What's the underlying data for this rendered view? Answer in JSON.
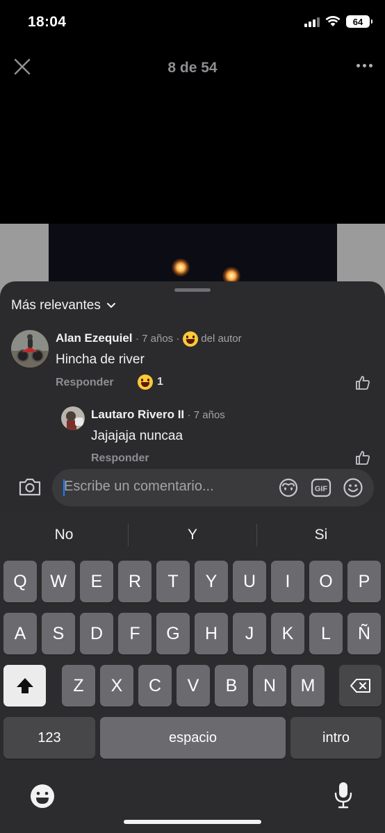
{
  "status_bar": {
    "time": "18:04",
    "battery": "64"
  },
  "viewer": {
    "counter": "8 de 54"
  },
  "comments_sheet": {
    "sort_label": "Más relevantes",
    "comments": [
      {
        "author": "Alan Ezequiel",
        "time": "· 7 años ·",
        "badge": "del autor",
        "text": "Hincha de river",
        "reply_label": "Responder",
        "reaction_count": "1"
      },
      {
        "author": "Lautaro Rivero II",
        "time": "· 7 años",
        "text": "Jajajaja nuncaa",
        "reply_label": "Responder"
      }
    ]
  },
  "composer": {
    "placeholder": "Escribe un comentario...",
    "gif_label": "GIF"
  },
  "keyboard": {
    "suggestions": [
      "No",
      "Y",
      "Si"
    ],
    "row1": [
      "Q",
      "W",
      "E",
      "R",
      "T",
      "Y",
      "U",
      "I",
      "O",
      "P"
    ],
    "row2": [
      "A",
      "S",
      "D",
      "F",
      "G",
      "H",
      "J",
      "K",
      "L",
      "Ñ"
    ],
    "row3": [
      "Z",
      "X",
      "C",
      "V",
      "B",
      "N",
      "M"
    ],
    "numbers_key": "123",
    "space_key": "espacio",
    "return_key": "intro"
  },
  "icons": [
    "close-icon",
    "more-icon",
    "chevron-down-icon",
    "like-icon",
    "camera-icon",
    "avatar-stickers-icon",
    "gif-icon",
    "emoji-icon",
    "shift-icon",
    "delete-icon",
    "keyboard-emoji-icon",
    "microphone-icon"
  ]
}
